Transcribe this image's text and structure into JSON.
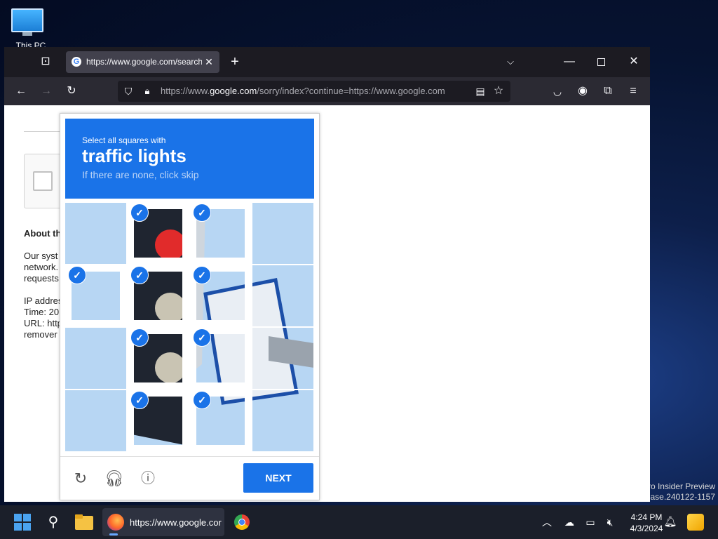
{
  "desktop": {
    "icon_label": "This PC"
  },
  "watermark": {
    "line1": "ro Insider Preview",
    "line2": "ease.240122-1157"
  },
  "browser": {
    "tab_title": "https://www.google.com/search",
    "url_prefix": "https://www.",
    "url_domain": "google.com",
    "url_rest": "/sorry/index?continue=https://www.google.com"
  },
  "page": {
    "about_heading": "About th",
    "paragraph": "Our syst\nnetwork.\nrequests",
    "details": "IP addres\nTime: 20\nURL: http\nremover"
  },
  "captcha": {
    "instruction": "Select all squares with",
    "object": "traffic lights",
    "hint": "If there are none, click skip",
    "next_label": "NEXT",
    "selected_tiles": [
      1,
      2,
      4,
      5,
      6,
      9,
      10,
      13,
      14
    ]
  },
  "taskbar": {
    "browser_label": "https://www.google.cor",
    "time": "4:24 PM",
    "date": "4/3/2024"
  },
  "colors": {
    "captcha_blue": "#1a73e8",
    "tabbar": "#1c1b22",
    "toolbar": "#2b2a33"
  }
}
